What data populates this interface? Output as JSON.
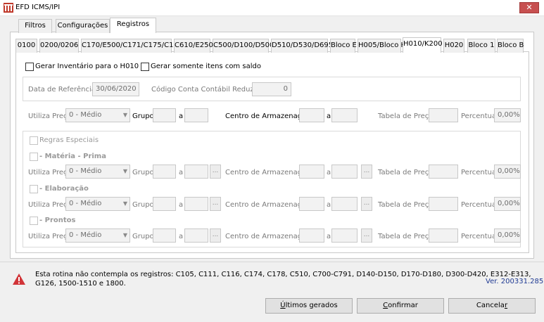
{
  "window": {
    "title": "EFD ICMS/IPI",
    "close_label": "✕"
  },
  "outer_tabs": [
    "Filtros",
    "Configurações",
    "Registros"
  ],
  "inner_tabs": [
    "0100",
    "0200/0206",
    "C170/E500/C171/C175/C176",
    "C610/E250",
    "C500/D100/D500",
    "D510/D530/D695",
    "Bloco E",
    "H005/Bloco K",
    "H010/K200",
    "H020",
    "Bloco 1",
    "Bloco B"
  ],
  "options": {
    "gerar_inventario": "Gerar Inventário para o H010",
    "gerar_somente": "Gerar somente itens com saldo"
  },
  "referencia": {
    "data_label": "Data de Referência",
    "data_value": "30/06/2020",
    "conta_label": "Código Conta Contábil Reduzido",
    "conta_value": "0"
  },
  "filter_labels": {
    "utiliza_preco": "Utiliza Preço",
    "grupo": "Grupo",
    "a": "a",
    "centro": "Centro de Armazenagem",
    "tabela": "Tabela de Preços",
    "percentual": "Percentual",
    "preco_option": "0 - Médio",
    "percent_value": "0,00%",
    "ellipsis": "..."
  },
  "regras": {
    "title": "Regras Especiais",
    "materia": "- Matéria - Prima",
    "elaboracao": "- Elaboração",
    "prontos": "- Prontos"
  },
  "footer": {
    "note_line1": "Esta rotina não contempla os registros: C105, C111, C116, C174, C178, C510, C700-C791, D140-D150, D170-D180, D300-D420, E312-E313,",
    "note_line2": "G126, 1500-1510 e 1800.",
    "version": "Ver. 200331.285"
  },
  "buttons": {
    "ultimos_u": "Ú",
    "ultimos_rest": "ltimos gerados",
    "confirmar_u": "C",
    "confirmar_rest": "onfirmar",
    "cancelar_start": "Cancela",
    "cancelar_u": "r"
  },
  "colors": {
    "accent": "#c75050",
    "version_text": "#1f3a93",
    "warning": "#d13438"
  }
}
